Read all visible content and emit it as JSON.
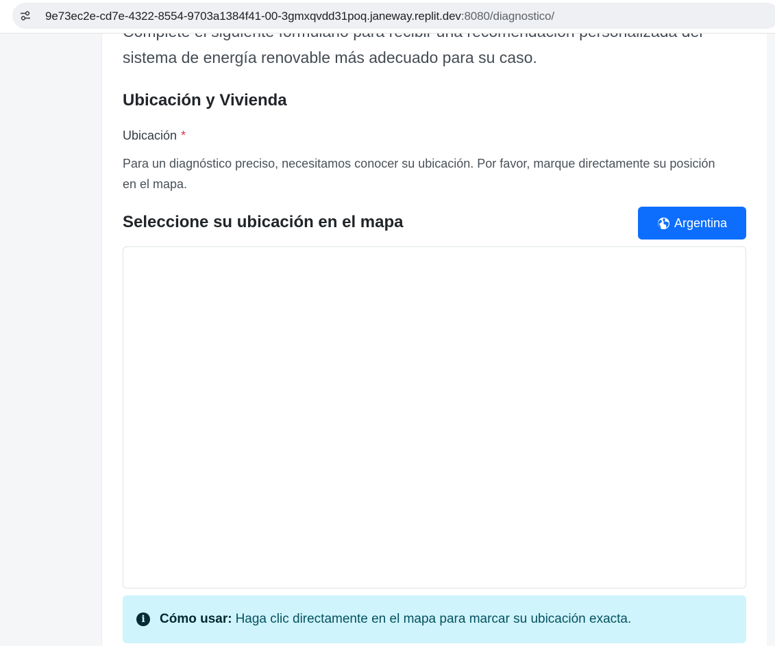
{
  "browser": {
    "url_host": "9e73ec2e-cd7e-4322-8554-9703a1384f41-00-3gmxqvdd31poq.janeway.replit.dev",
    "url_rest": ":8080/diagnostico/",
    "site_info_icon": "tune-icon"
  },
  "form": {
    "lead_text": "Complete el siguiente formulario para recibir una recomendación personalizada del sistema de energía renovable más adecuado para su caso.",
    "section_title": "Ubicación y Vivienda",
    "location_label": "Ubicación",
    "required_mark": "*",
    "help_text": "Para un diagnóstico preciso, necesitamos conocer su ubicación. Por favor, marque directamente su posición en el mapa.",
    "map_title": "Seleccione su ubicación en el mapa",
    "country_button": {
      "label": "Argentina",
      "icon": "globe-icon",
      "color": "#0d6efd"
    },
    "info_alert": {
      "icon": "info-icon",
      "strong": "Cómo usar:",
      "text": "Haga clic directamente en el mapa para marcar su ubicación exacta.",
      "background": "#cff4fc"
    }
  }
}
